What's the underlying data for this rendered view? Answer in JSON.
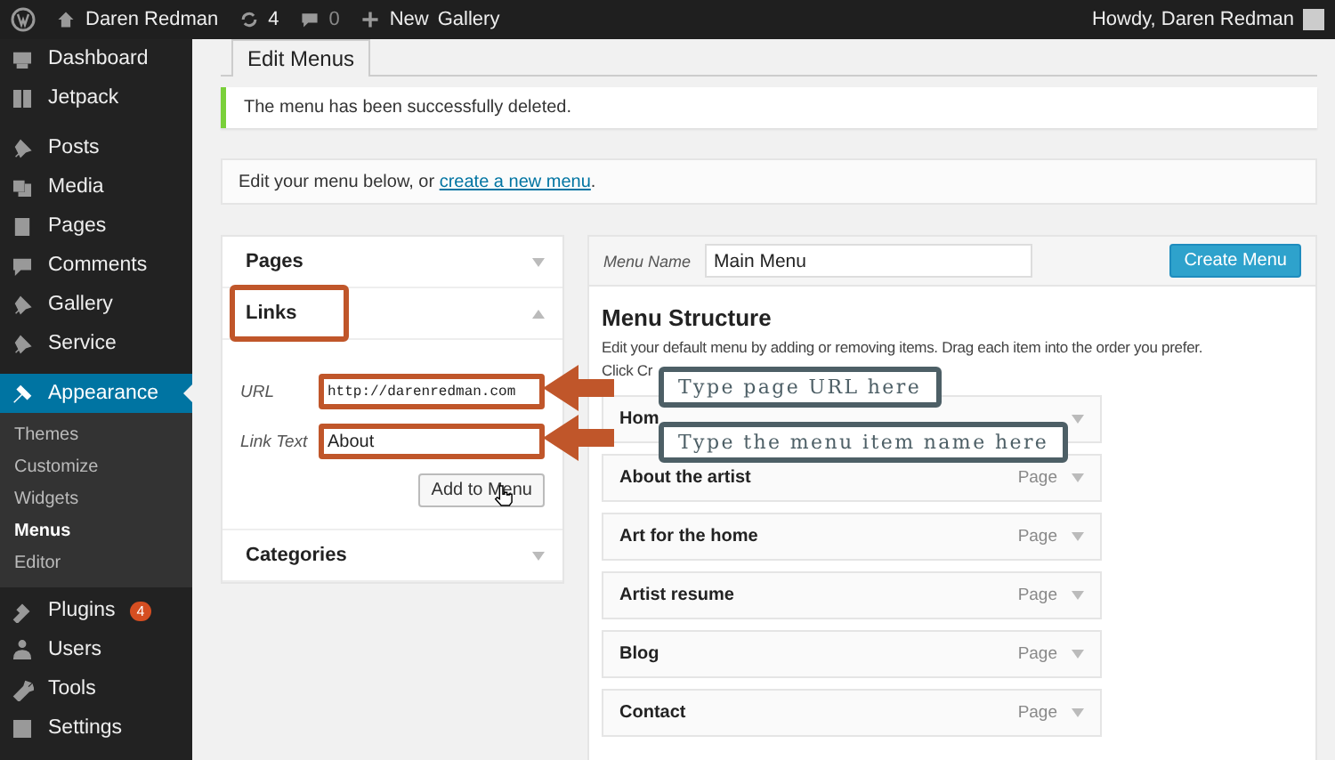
{
  "admin_bar": {
    "site_name": "Daren Redman",
    "updates": "4",
    "comments": "0",
    "new": "New",
    "gallery": "Gallery",
    "greeting": "Howdy, Daren Redman"
  },
  "sidebar": {
    "items": [
      {
        "label": "Dashboard",
        "selected": false
      },
      {
        "label": "Jetpack",
        "selected": false
      },
      {
        "label": "Posts",
        "selected": false
      },
      {
        "label": "Media",
        "selected": false
      },
      {
        "label": "Pages",
        "selected": false
      },
      {
        "label": "Comments",
        "selected": false
      },
      {
        "label": "Gallery",
        "selected": false
      },
      {
        "label": "Service",
        "selected": false
      },
      {
        "label": "Appearance",
        "selected": true,
        "children": [
          {
            "label": "Themes",
            "selected": false
          },
          {
            "label": "Customize",
            "selected": false
          },
          {
            "label": "Widgets",
            "selected": false
          },
          {
            "label": "Menus",
            "selected": true
          },
          {
            "label": "Editor",
            "selected": false
          }
        ]
      },
      {
        "label": "Plugins",
        "selected": false,
        "badge": "4"
      },
      {
        "label": "Users",
        "selected": false
      },
      {
        "label": "Tools",
        "selected": false
      },
      {
        "label": "Settings",
        "selected": false
      }
    ]
  },
  "tabs": [
    {
      "label": "Edit Menus",
      "selected": true
    }
  ],
  "notice": "The menu has been successfully deleted.",
  "intro": {
    "text": "Edit your menu below, or ",
    "link": "create a new menu",
    "end": "."
  },
  "accordion": [
    {
      "title": "Pages",
      "expanded": false,
      "highlighted": false
    },
    {
      "title": "Links",
      "expanded": true,
      "highlighted": true,
      "fields": [
        {
          "label": "URL",
          "value": "http://darenredman.com",
          "highlighted": true
        },
        {
          "label": "Link Text",
          "value": "About",
          "highlighted": true
        }
      ],
      "button": "Add to Menu"
    },
    {
      "title": "Categories",
      "expanded": false,
      "highlighted": false
    }
  ],
  "menu": {
    "name_label": "Menu Name",
    "name": "Main Menu",
    "create_button": "Create Menu",
    "heading": "Menu Structure",
    "description": "Edit your default menu by adding or removing items. Drag each item into the order you prefer.",
    "description_cont": "Click Cr",
    "items": [
      {
        "title": "Hom"
      },
      {
        "title": "About the artist",
        "type": "Page"
      },
      {
        "title": "Art for the home",
        "type": "Page"
      },
      {
        "title": "Artist resume",
        "type": "Page"
      },
      {
        "title": "Blog",
        "type": "Page"
      },
      {
        "title": "Contact",
        "type": "Page"
      }
    ]
  },
  "callouts": [
    {
      "text": "Type page URL here"
    },
    {
      "text": "Type the menu item name here"
    }
  ]
}
